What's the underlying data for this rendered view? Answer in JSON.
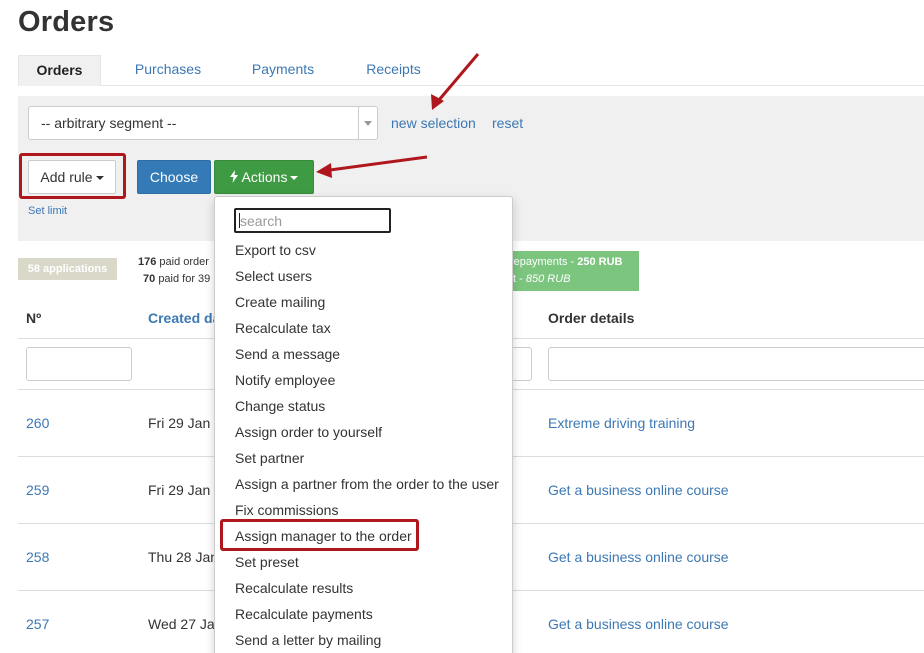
{
  "page": {
    "title": "Orders"
  },
  "tabs": [
    {
      "label": "Orders",
      "active": true
    },
    {
      "label": "Purchases",
      "active": false
    },
    {
      "label": "Payments",
      "active": false
    },
    {
      "label": "Receipts",
      "active": false
    }
  ],
  "filter": {
    "segment_value": "-- arbitrary segment --",
    "new_selection": "new selection",
    "reset": "reset",
    "add_rule": "Add rule",
    "choose": "Choose",
    "actions": "Actions",
    "set_limit": "Set limit"
  },
  "stats": {
    "applications_badge": "58 applications",
    "paid_orders_count": "176",
    "paid_orders_text": "paid order",
    "paid_for_count": "70",
    "paid_for_text": "paid for 39",
    "prepayments_text": "repayments - ",
    "prepayments_value": "250 RUB",
    "left_text": "ft - ",
    "left_value": "850 RUB"
  },
  "table": {
    "headers": {
      "number": "Nº",
      "created": "Created da",
      "details": "Order details"
    },
    "rows": [
      {
        "number": "260",
        "date": "Fri 29 Jan 1",
        "details": "Extreme driving training"
      },
      {
        "number": "259",
        "date": "Fri 29 Jan 1",
        "details": "Get a business online course"
      },
      {
        "number": "258",
        "date": "Thu 28 Jan",
        "details": "Get a business online course"
      },
      {
        "number": "257",
        "date": "Wed 27 Jan",
        "details": "Get a business online course"
      }
    ]
  },
  "actions_menu": {
    "search_placeholder": "search",
    "items": [
      "Export to csv",
      "Select users",
      "Create mailing",
      "Recalculate tax",
      "Send a message",
      "Notify employee",
      "Change status",
      "Assign order to yourself",
      "Set partner",
      "Assign a partner from the order to the user",
      "Fix commissions",
      "Assign manager to the order",
      "Set preset",
      "Recalculate results",
      "Recalculate payments",
      "Send a letter by mailing"
    ]
  },
  "colors": {
    "link": "#3c78b4",
    "highlight_red": "#b0171c",
    "primary_button": "#337ab7",
    "success_button": "#3e9a43",
    "green_stats": "#7cc57f"
  }
}
